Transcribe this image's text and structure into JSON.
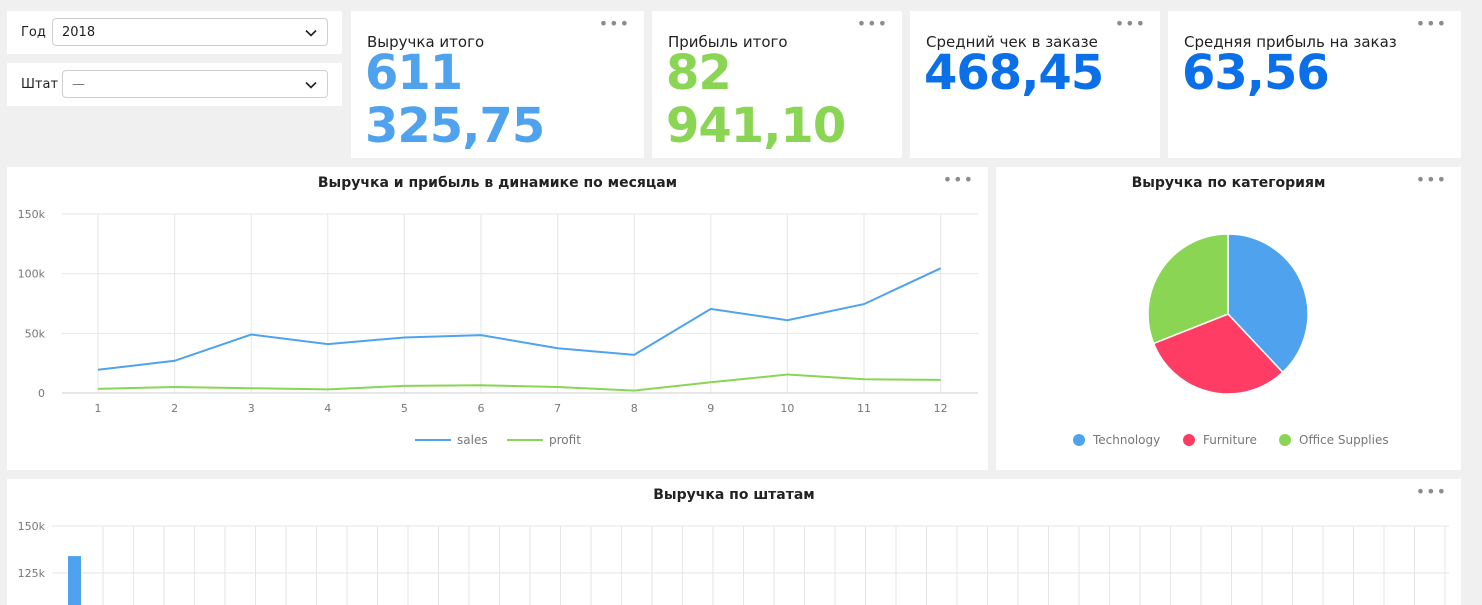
{
  "filters": {
    "year": {
      "label": "Год",
      "value": "2018"
    },
    "state": {
      "label": "Штат",
      "value": "—"
    }
  },
  "kpis": [
    {
      "title": "Выручка итого",
      "value": "611 325,75",
      "color": "#4fa2ed"
    },
    {
      "title": "Прибыль итого",
      "value": "82 941,10",
      "color": "#8ad554"
    },
    {
      "title": "Средний чек в заказе",
      "value": "468,45",
      "color": "#0b6fe8"
    },
    {
      "title": "Средняя прибыль на заказ",
      "value": "63,56",
      "color": "#0b6fe8"
    }
  ],
  "menu_icon": "more-dots-icon",
  "colors": {
    "sales": "#4fa2ed",
    "profit": "#8ad554",
    "technology": "#4fa2ed",
    "furniture": "#ff3d64",
    "office": "#8ad554"
  },
  "chart_data": [
    {
      "type": "line",
      "title": "Выручка и прибыль в динамике по месяцам",
      "x": [
        "1",
        "2",
        "3",
        "4",
        "5",
        "6",
        "7",
        "8",
        "9",
        "10",
        "11",
        "12"
      ],
      "ylim": [
        0,
        150000
      ],
      "yticks": [
        "0",
        "50k",
        "100k",
        "150k"
      ],
      "series": [
        {
          "name": "sales",
          "values": [
            19500,
            27000,
            49000,
            41000,
            46500,
            48500,
            37500,
            32000,
            70500,
            61000,
            74500,
            104500
          ]
        },
        {
          "name": "profit",
          "values": [
            3500,
            5000,
            4000,
            3000,
            6000,
            6500,
            5000,
            2000,
            9000,
            15500,
            11500,
            11000
          ]
        }
      ],
      "grid": true,
      "legend": "bottom"
    },
    {
      "type": "pie",
      "title": "Выручка по категориям",
      "categories": [
        "Technology",
        "Furniture",
        "Office Supplies"
      ],
      "values": [
        38,
        31,
        31
      ],
      "legend": "bottom"
    },
    {
      "type": "bar",
      "title": "Выручка по штатам",
      "ylim": [
        100000,
        150000
      ],
      "yticks": [
        "150k",
        "125k"
      ],
      "values": [
        134000
      ],
      "grid": true
    }
  ]
}
